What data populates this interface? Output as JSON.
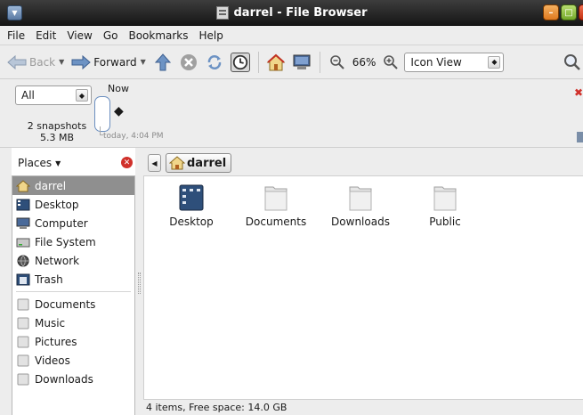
{
  "window": {
    "title": "darrel - File Browser"
  },
  "menubar": {
    "items": [
      "File",
      "Edit",
      "View",
      "Go",
      "Bookmarks",
      "Help"
    ]
  },
  "toolbar": {
    "back_label": "Back",
    "forward_label": "Forward",
    "zoom_level": "66%",
    "view_mode": "Icon View"
  },
  "timeline": {
    "filter": "All",
    "snapshot_count": "2 snapshots",
    "snapshot_size": "5.3 MB",
    "now_label": "Now",
    "snapshot_time": "today, 4:04 PM"
  },
  "sidebar": {
    "header": "Places",
    "places": [
      {
        "label": "darrel",
        "icon": "home-icon",
        "selected": true
      },
      {
        "label": "Desktop",
        "icon": "desktop-icon"
      },
      {
        "label": "Computer",
        "icon": "computer-icon"
      },
      {
        "label": "File System",
        "icon": "drive-icon"
      },
      {
        "label": "Network",
        "icon": "network-icon"
      },
      {
        "label": "Trash",
        "icon": "trash-icon"
      }
    ],
    "bookmarks": [
      {
        "label": "Documents",
        "icon": "folder-icon"
      },
      {
        "label": "Music",
        "icon": "folder-icon"
      },
      {
        "label": "Pictures",
        "icon": "folder-icon"
      },
      {
        "label": "Videos",
        "icon": "folder-icon"
      },
      {
        "label": "Downloads",
        "icon": "folder-icon"
      }
    ]
  },
  "pathbar": {
    "current": "darrel"
  },
  "files": [
    {
      "name": "Desktop",
      "icon": "desktop-folder-icon"
    },
    {
      "name": "Documents",
      "icon": "folder-icon"
    },
    {
      "name": "Downloads",
      "icon": "folder-icon"
    },
    {
      "name": "Public",
      "icon": "folder-icon"
    }
  ],
  "status": {
    "text": "4 items, Free space: 14.0 GB"
  },
  "colors": {
    "selection": "#8f8f8f",
    "titlebar": "#1f1f1f",
    "close": "#d0302a"
  }
}
